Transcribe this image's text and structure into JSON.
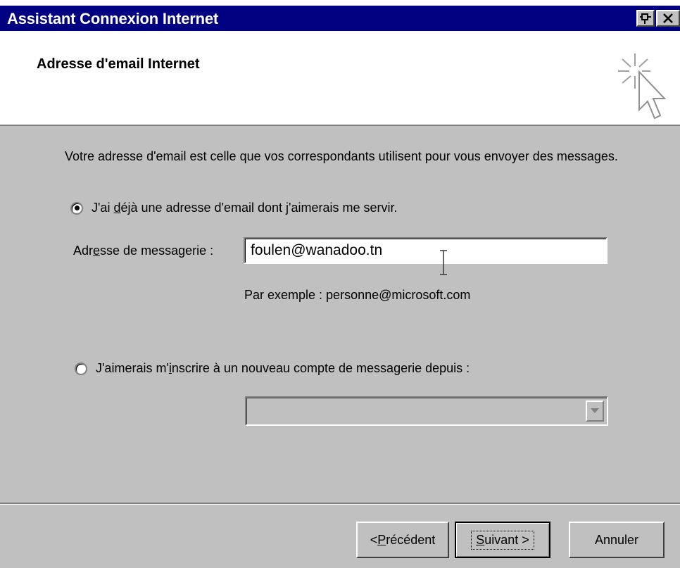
{
  "window": {
    "title": "Assistant Connexion Internet"
  },
  "header": {
    "title": "Adresse d'email Internet",
    "icon": "wizard-cursor-icon"
  },
  "body": {
    "description": "Votre adresse d'email est celle que vos correspondants utilisent pour vous envoyer des messages.",
    "option_existing": {
      "prefix": "J'ai ",
      "mnemonic": "d",
      "suffix": "éjà une adresse d'email dont j'aimerais me servir.",
      "checked": true
    },
    "email_field": {
      "label_prefix": "Adr",
      "label_mnemonic": "e",
      "label_suffix": "sse de messagerie :",
      "value": "foulen@wanadoo.tn"
    },
    "example": "Par exemple : personne@microsoft.com",
    "option_new": {
      "prefix": "J'aimerais m'",
      "mnemonic": "i",
      "suffix": "nscrire à un nouveau compte de messagerie depuis :",
      "checked": false
    },
    "provider_dropdown": {
      "value": ""
    }
  },
  "footer": {
    "back": {
      "prefix": "< ",
      "mnemonic": "P",
      "suffix": "récédent"
    },
    "next": {
      "mnemonic": "S",
      "suffix": "uivant >"
    },
    "cancel": {
      "label": "Annuler"
    }
  }
}
